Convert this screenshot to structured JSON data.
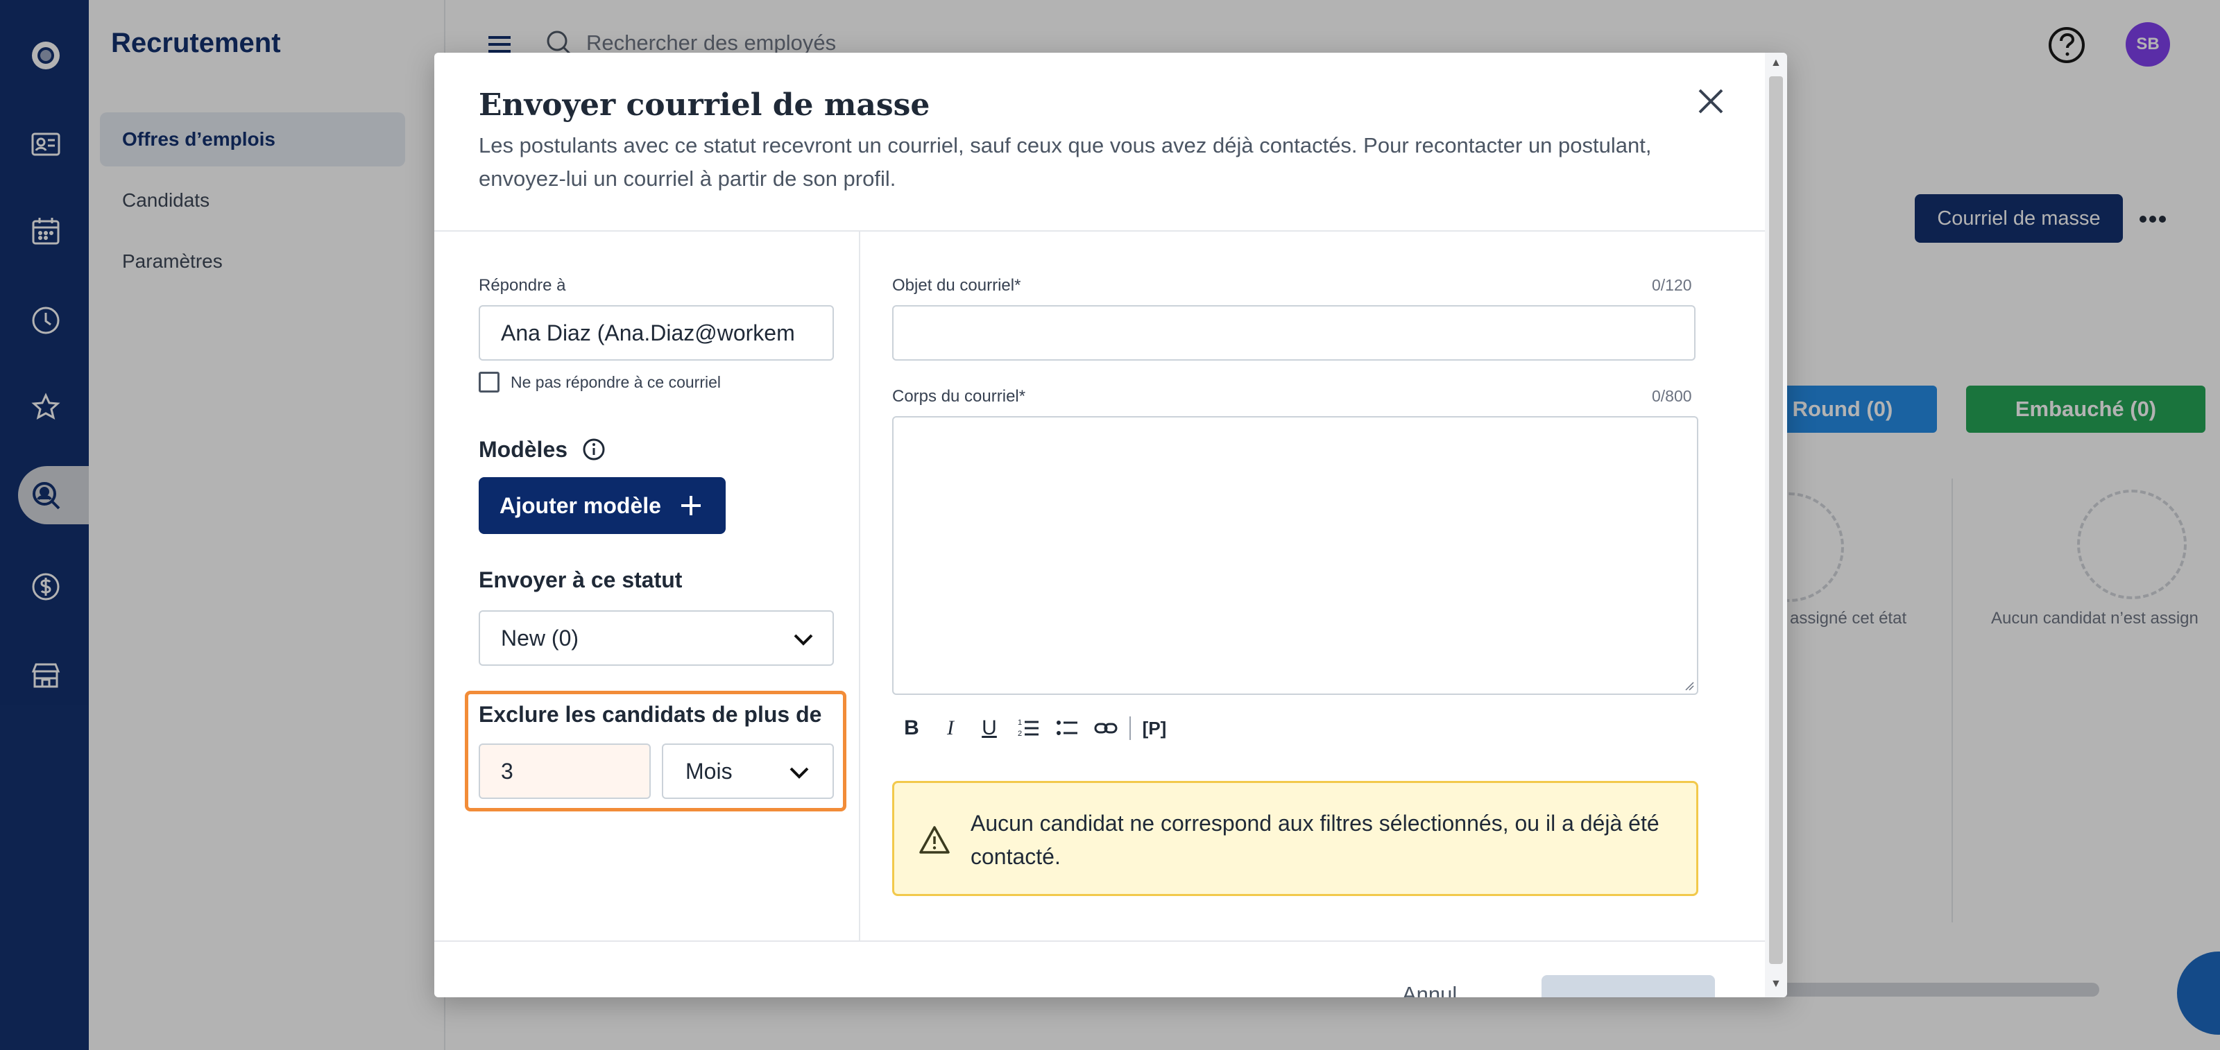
{
  "sidebar": {
    "title": "Recrutement",
    "items": [
      {
        "label": "Offres d’emplois",
        "active": true
      },
      {
        "label": "Candidats",
        "active": false
      },
      {
        "label": "Paramètres",
        "active": false
      }
    ]
  },
  "topbar": {
    "search_placeholder": "Rechercher des employés",
    "avatar_initials": "SB"
  },
  "background": {
    "mass_email_button": "Courriel de masse",
    "stages": [
      {
        "label": "Round (0)",
        "color": "#1e88e5"
      },
      {
        "label": "Embauché (0)",
        "color": "#1ea351"
      }
    ],
    "empty_texts": [
      "assigné cet état",
      "Aucun candidat n’est assign"
    ]
  },
  "modal": {
    "title": "Envoyer courriel de masse",
    "description": "Les postulants avec ce statut recevront un courriel, sauf ceux que vous avez déjà contactés. Pour recontacter un postulant, envoyez-lui un courriel à partir de son profil.",
    "reply_to": {
      "label": "Répondre à",
      "value": "Ana Diaz (Ana.Diaz@workem"
    },
    "no_reply_checkbox": {
      "label": "Ne pas répondre à ce courriel",
      "checked": false
    },
    "templates": {
      "label": "Modèles",
      "add_button": "Ajouter modèle"
    },
    "send_status": {
      "label": "Envoyer à ce statut",
      "selected": "New (0)"
    },
    "exclude": {
      "label": "Exclure les candidats de plus de",
      "amount": "3",
      "unit": "Mois"
    },
    "subject": {
      "label": "Objet du courriel*",
      "counter": "0/120",
      "value": ""
    },
    "body": {
      "label": "Corps du courriel*",
      "counter": "0/800",
      "value": ""
    },
    "toolbar": {
      "bold": "B",
      "italic": "I",
      "underline": "U",
      "placeholder_tag": "[P]"
    },
    "alert": {
      "text": "Aucun candidat ne correspond aux filtres sélectionnés, ou il a déjà été contacté."
    },
    "footer": {
      "cancel_partial": "Annul"
    }
  }
}
